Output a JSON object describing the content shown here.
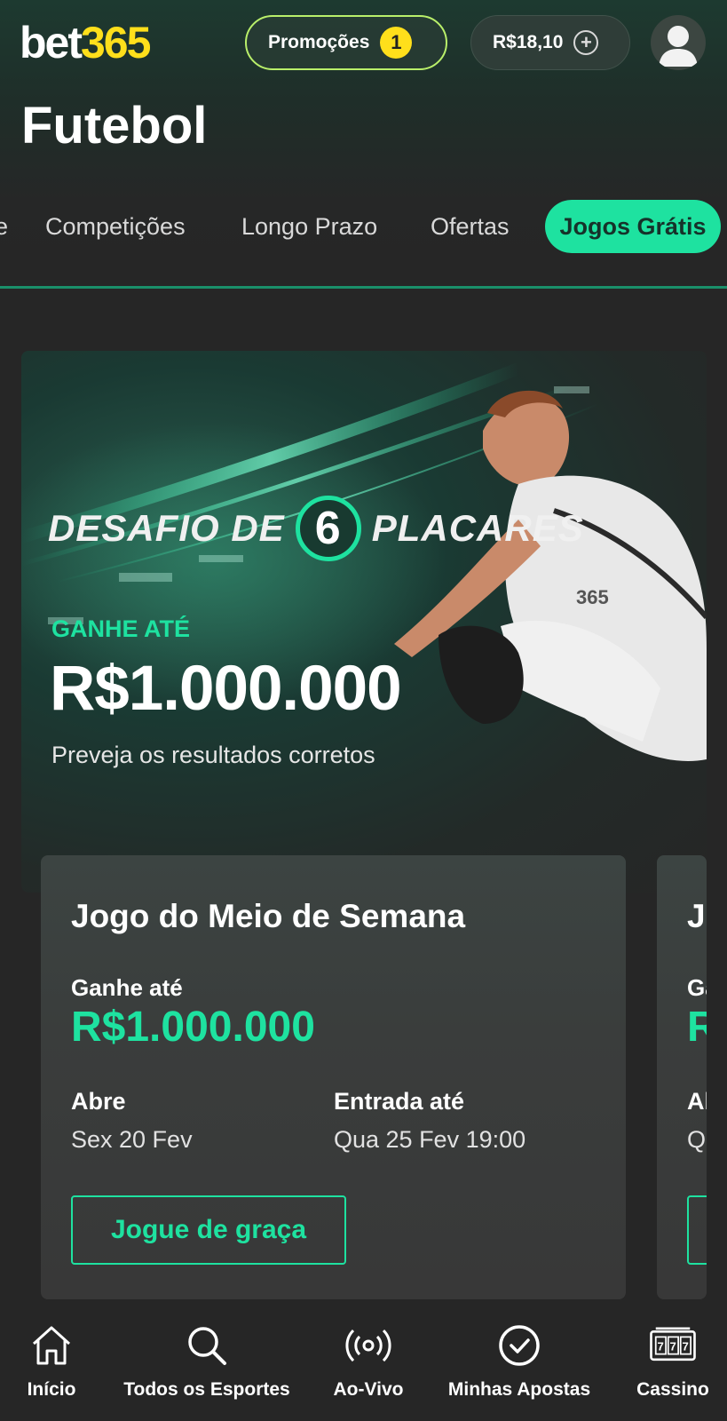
{
  "header": {
    "logo_part1": "bet",
    "logo_part2": "365",
    "promo_label": "Promoções",
    "promo_count": "1",
    "balance": "R$18,10"
  },
  "page_title": "Futebol",
  "tabs": [
    {
      "label": "e"
    },
    {
      "label": "Competições"
    },
    {
      "label": "Longo Prazo"
    },
    {
      "label": "Ofertas"
    },
    {
      "label": "Jogos Grátis",
      "active": true
    }
  ],
  "banner": {
    "title_left": "DESAFIO DE",
    "title_number": "6",
    "title_right": "PLACARES",
    "jersey_text": "365",
    "win_label": "GANHE ATÉ",
    "win_amount": "R$1.000.000",
    "subtitle": "Preveja os resultados corretos"
  },
  "cards": [
    {
      "title": "Jogo do Meio de Semana",
      "win_label": "Ganhe até",
      "win_amount": "R$1.000.000",
      "opens_label": "Abre",
      "opens_value": "Sex 20 Fev",
      "entry_label": "Entrada até",
      "entry_value": "Qua 25 Fev 19:00",
      "button_label": "Jogue de graça"
    },
    {
      "title": "J",
      "win_label": "Ga",
      "win_amount": "R",
      "opens_label": "Al",
      "opens_value": "Q"
    }
  ],
  "bottom_nav": [
    {
      "label": "Início",
      "icon": "home-icon"
    },
    {
      "label": "Todos os Esportes",
      "icon": "search-icon"
    },
    {
      "label": "Ao-Vivo",
      "icon": "live-broadcast-icon"
    },
    {
      "label": "Minhas Apostas",
      "icon": "check-circle-icon"
    },
    {
      "label": "Cassino",
      "icon": "slot-machine-icon"
    }
  ],
  "colors": {
    "accent_green": "#1ee2a0",
    "logo_yellow": "#ffdf1b",
    "promo_border": "#b9ef6a",
    "background": "#262626"
  }
}
